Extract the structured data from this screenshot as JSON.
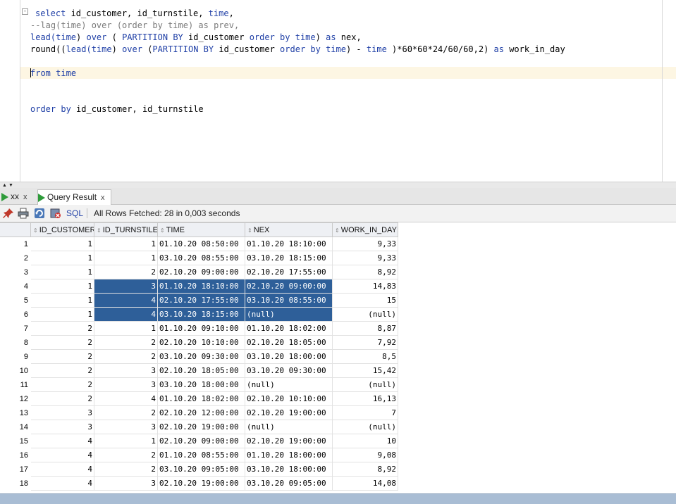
{
  "editor": {
    "fold_glyph": "-",
    "lines": [
      [
        {
          "t": "select ",
          "c": "kw"
        },
        {
          "t": "id_customer, id_turnstile, ",
          "c": ""
        },
        {
          "t": "time",
          "c": "kw"
        },
        {
          "t": ",",
          "c": ""
        }
      ],
      [
        {
          "t": "--lag(time) over (order by time) as prev,",
          "c": "cm"
        }
      ],
      [
        {
          "t": "lead(",
          "c": "kw"
        },
        {
          "t": "time",
          "c": "kw"
        },
        {
          "t": ") ",
          "c": ""
        },
        {
          "t": "over",
          "c": "kw"
        },
        {
          "t": " ( ",
          "c": ""
        },
        {
          "t": "PARTITION BY",
          "c": "kw"
        },
        {
          "t": " id_customer ",
          "c": ""
        },
        {
          "t": "order by",
          "c": "kw"
        },
        {
          "t": " ",
          "c": ""
        },
        {
          "t": "time",
          "c": "kw"
        },
        {
          "t": ") ",
          "c": ""
        },
        {
          "t": "as",
          "c": "kw"
        },
        {
          "t": " nex,",
          "c": ""
        }
      ],
      [
        {
          "t": "round((",
          "c": ""
        },
        {
          "t": "lead(",
          "c": "kw"
        },
        {
          "t": "time",
          "c": "kw"
        },
        {
          "t": ") ",
          "c": ""
        },
        {
          "t": "over",
          "c": "kw"
        },
        {
          "t": " (",
          "c": ""
        },
        {
          "t": "PARTITION BY",
          "c": "kw"
        },
        {
          "t": " id_customer ",
          "c": ""
        },
        {
          "t": "order by",
          "c": "kw"
        },
        {
          "t": " ",
          "c": ""
        },
        {
          "t": "time",
          "c": "kw"
        },
        {
          "t": ") - ",
          "c": ""
        },
        {
          "t": "time",
          "c": "kw"
        },
        {
          "t": " )*60*60*24/60/60,2) ",
          "c": ""
        },
        {
          "t": "as",
          "c": "kw"
        },
        {
          "t": " work_in_day",
          "c": ""
        }
      ],
      [],
      [
        {
          "t": "from",
          "c": "kw"
        },
        {
          "t": " ",
          "c": ""
        },
        {
          "t": "time",
          "c": "kw"
        }
      ],
      [],
      [],
      [
        {
          "t": "order by",
          "c": "kw"
        },
        {
          "t": " id_customer, id_turnstile",
          "c": ""
        }
      ]
    ]
  },
  "splitter": {
    "up": "▲",
    "down": "▼"
  },
  "tabs": [
    {
      "label": "xx",
      "close": "x",
      "active": false
    },
    {
      "label": "Query Result",
      "close": "x",
      "active": true
    }
  ],
  "toolbar": {
    "sql_label": "SQL",
    "status": "All Rows Fetched: 28 in 0,003 seconds"
  },
  "grid": {
    "sort_glyph": "⇕",
    "columns": [
      "ID_CUSTOMER",
      "ID_TURNSTILE",
      "TIME",
      "NEX",
      "WORK_IN_DAY"
    ],
    "rows": [
      {
        "n": "1",
        "c": [
          "1",
          "1",
          "01.10.20 08:50:00",
          "01.10.20 18:10:00",
          "9,33"
        ],
        "sel": false
      },
      {
        "n": "2",
        "c": [
          "1",
          "1",
          "03.10.20 08:55:00",
          "03.10.20 18:15:00",
          "9,33"
        ],
        "sel": false
      },
      {
        "n": "3",
        "c": [
          "1",
          "2",
          "02.10.20 09:00:00",
          "02.10.20 17:55:00",
          "8,92"
        ],
        "sel": false
      },
      {
        "n": "4",
        "c": [
          "1",
          "3",
          "01.10.20 18:10:00",
          "02.10.20 09:00:00",
          "14,83"
        ],
        "sel": true
      },
      {
        "n": "5",
        "c": [
          "1",
          "4",
          "02.10.20 17:55:00",
          "03.10.20 08:55:00",
          "15"
        ],
        "sel": true
      },
      {
        "n": "6",
        "c": [
          "1",
          "4",
          "03.10.20 18:15:00",
          "(null)",
          "(null)"
        ],
        "sel": true
      },
      {
        "n": "7",
        "c": [
          "2",
          "1",
          "01.10.20 09:10:00",
          "01.10.20 18:02:00",
          "8,87"
        ],
        "sel": false
      },
      {
        "n": "8",
        "c": [
          "2",
          "2",
          "02.10.20 10:10:00",
          "02.10.20 18:05:00",
          "7,92"
        ],
        "sel": false
      },
      {
        "n": "9",
        "c": [
          "2",
          "2",
          "03.10.20 09:30:00",
          "03.10.20 18:00:00",
          "8,5"
        ],
        "sel": false
      },
      {
        "n": "10",
        "c": [
          "2",
          "3",
          "02.10.20 18:05:00",
          "03.10.20 09:30:00",
          "15,42"
        ],
        "sel": false
      },
      {
        "n": "11",
        "c": [
          "2",
          "3",
          "03.10.20 18:00:00",
          "(null)",
          "(null)"
        ],
        "sel": false
      },
      {
        "n": "12",
        "c": [
          "2",
          "4",
          "01.10.20 18:02:00",
          "02.10.20 10:10:00",
          "16,13"
        ],
        "sel": false
      },
      {
        "n": "13",
        "c": [
          "3",
          "2",
          "02.10.20 12:00:00",
          "02.10.20 19:00:00",
          "7"
        ],
        "sel": false
      },
      {
        "n": "14",
        "c": [
          "3",
          "3",
          "02.10.20 19:00:00",
          "(null)",
          "(null)"
        ],
        "sel": false
      },
      {
        "n": "15",
        "c": [
          "4",
          "1",
          "02.10.20 09:00:00",
          "02.10.20 19:00:00",
          "10"
        ],
        "sel": false
      },
      {
        "n": "16",
        "c": [
          "4",
          "2",
          "01.10.20 08:55:00",
          "01.10.20 18:00:00",
          "9,08"
        ],
        "sel": false
      },
      {
        "n": "17",
        "c": [
          "4",
          "2",
          "03.10.20 09:05:00",
          "03.10.20 18:00:00",
          "8,92"
        ],
        "sel": false
      },
      {
        "n": "18",
        "c": [
          "4",
          "3",
          "02.10.20 19:00:00",
          "03.10.20 09:05:00",
          "14,08"
        ],
        "sel": false
      }
    ]
  },
  "colors": {
    "selection": "#2e5f99",
    "keyword": "#1f3fa6",
    "comment": "#7a7a7a",
    "run_icon": "#2e9b3a"
  }
}
